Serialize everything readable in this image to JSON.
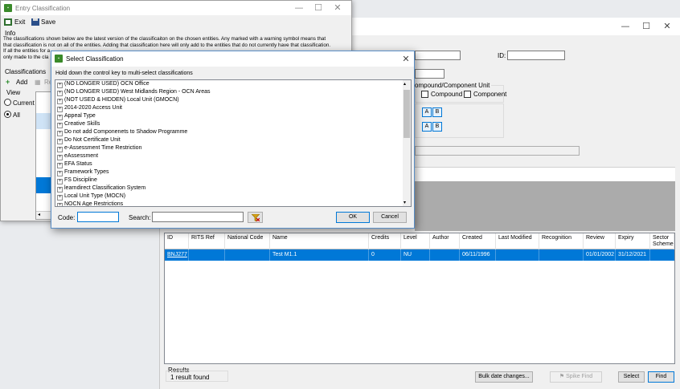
{
  "main_window": {
    "id_label": "ID:",
    "compound_group_label": "ompound/Component Unit",
    "compound_label": "Compound",
    "component_label": "Component",
    "a_label": "A",
    "b_label": "B",
    "grid": {
      "headers": [
        "ID",
        "RITS Ref",
        "National Code",
        "Name",
        "Credits",
        "Level",
        "Author",
        "Created",
        "Last Modified",
        "Recognition",
        "Review",
        "Expiry",
        "Sector Schemes"
      ],
      "rows": [
        {
          "id": "BNJ277",
          "rits_ref": "",
          "national_code": "",
          "name": "Test M1.1",
          "credits": "0",
          "level": "NU",
          "author": "",
          "created": "06/11/1996",
          "last_modified": "",
          "recognition": "",
          "review": "01/01/2002",
          "expiry": "31/12/2021",
          "sector_schemes": ""
        }
      ]
    },
    "results_label": "Results",
    "results_text": "1 result found",
    "bulk_button": "Bulk date changes...",
    "spike_button": "Spike Find",
    "select_button": "Select",
    "find_button": "Find"
  },
  "entry_window": {
    "title": "Entry Classification",
    "toolbar": {
      "exit_label": "Exit",
      "save_label": "Save"
    },
    "info_label": "Info",
    "info_lines": [
      "The classifications shown below are the latest version of the classificaiton on the chosen entities. Any marked with a warning symbol means that",
      "that classification is not on all of the entities. Adding that classification here will only add to the entities that do not currently have that classification.",
      "If all the entities for a",
      "only made to the cla"
    ],
    "classifications_label": "Classifications",
    "add_label": "Add",
    "re_label": "Re",
    "view_label": "View",
    "view_options": [
      "Current",
      "All"
    ]
  },
  "dialog": {
    "title": "Select Classification",
    "instruction": "Hold down the control key to multi-select classifications",
    "items": [
      "(NO LONGER USED) OCN Office",
      "(NO LONGER USED) West Midlands Region - OCN Areas",
      "(NOT USED & HIDDEN) Local Unit (GMOCN)",
      "2014-2020 Access Unit",
      "Appeal Type",
      "Creative Skills",
      "Do not add Componenets to Shadow Programme",
      "Do Not Certificate Unit",
      "e-Assessment Time Restriction",
      "eAssessment",
      "EFA Status",
      "Framework Types",
      "FS Discipline",
      "learndirect Classification System",
      "Local Unit Type (MOCN)",
      "NOCN Age Restrictions"
    ],
    "code_label": "Code:",
    "code_value": "",
    "search_label": "Search:",
    "search_value": "",
    "ok_label": "OK",
    "cancel_label": "Cancel"
  },
  "colors": {
    "accent": "#0078d7",
    "app_icon": "#3a8a2a"
  }
}
